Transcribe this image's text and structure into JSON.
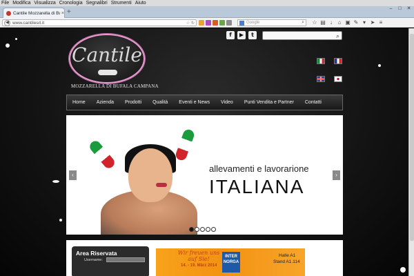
{
  "browser": {
    "menus": [
      "File",
      "Modifica",
      "Visualizza",
      "Cronologia",
      "Segnalibri",
      "Strumenti",
      "Aiuto"
    ],
    "tab_title": "Cantile Mozzarella di Bufala C...",
    "url": "www.cantilesrl.it",
    "search_placeholder": "Google",
    "new_tab_symbol": "+"
  },
  "header": {
    "logo_text": "Cantile",
    "tagline": "MOZZARELLA DI BUFALA CAMPANA",
    "social": [
      {
        "name": "facebook-icon",
        "glyph": "f"
      },
      {
        "name": "youtube-icon",
        "glyph": "▶"
      },
      {
        "name": "twitter-icon",
        "glyph": "t"
      }
    ],
    "languages": [
      "Italiano",
      "Français",
      "English",
      "日本語"
    ]
  },
  "menu": [
    "Home",
    "Azienda",
    "Prodotti",
    "Qualità",
    "Eventi e News",
    "Video",
    "Punti Vendita e Partner",
    "Contatti"
  ],
  "slider": {
    "line1": "allevamenti e lavorarione",
    "line2": "ITALIANA",
    "slide_count": 5,
    "active_slide": 1
  },
  "login": {
    "title": "Area Riservata",
    "username_label": "Username:"
  },
  "promo": {
    "headline": "Wir freuen uns auf Sie!",
    "dates": "14. - 19. März 2014",
    "brand": "INTER NORGA",
    "hall": "Halle A1",
    "stand": "Stand A1.114"
  }
}
